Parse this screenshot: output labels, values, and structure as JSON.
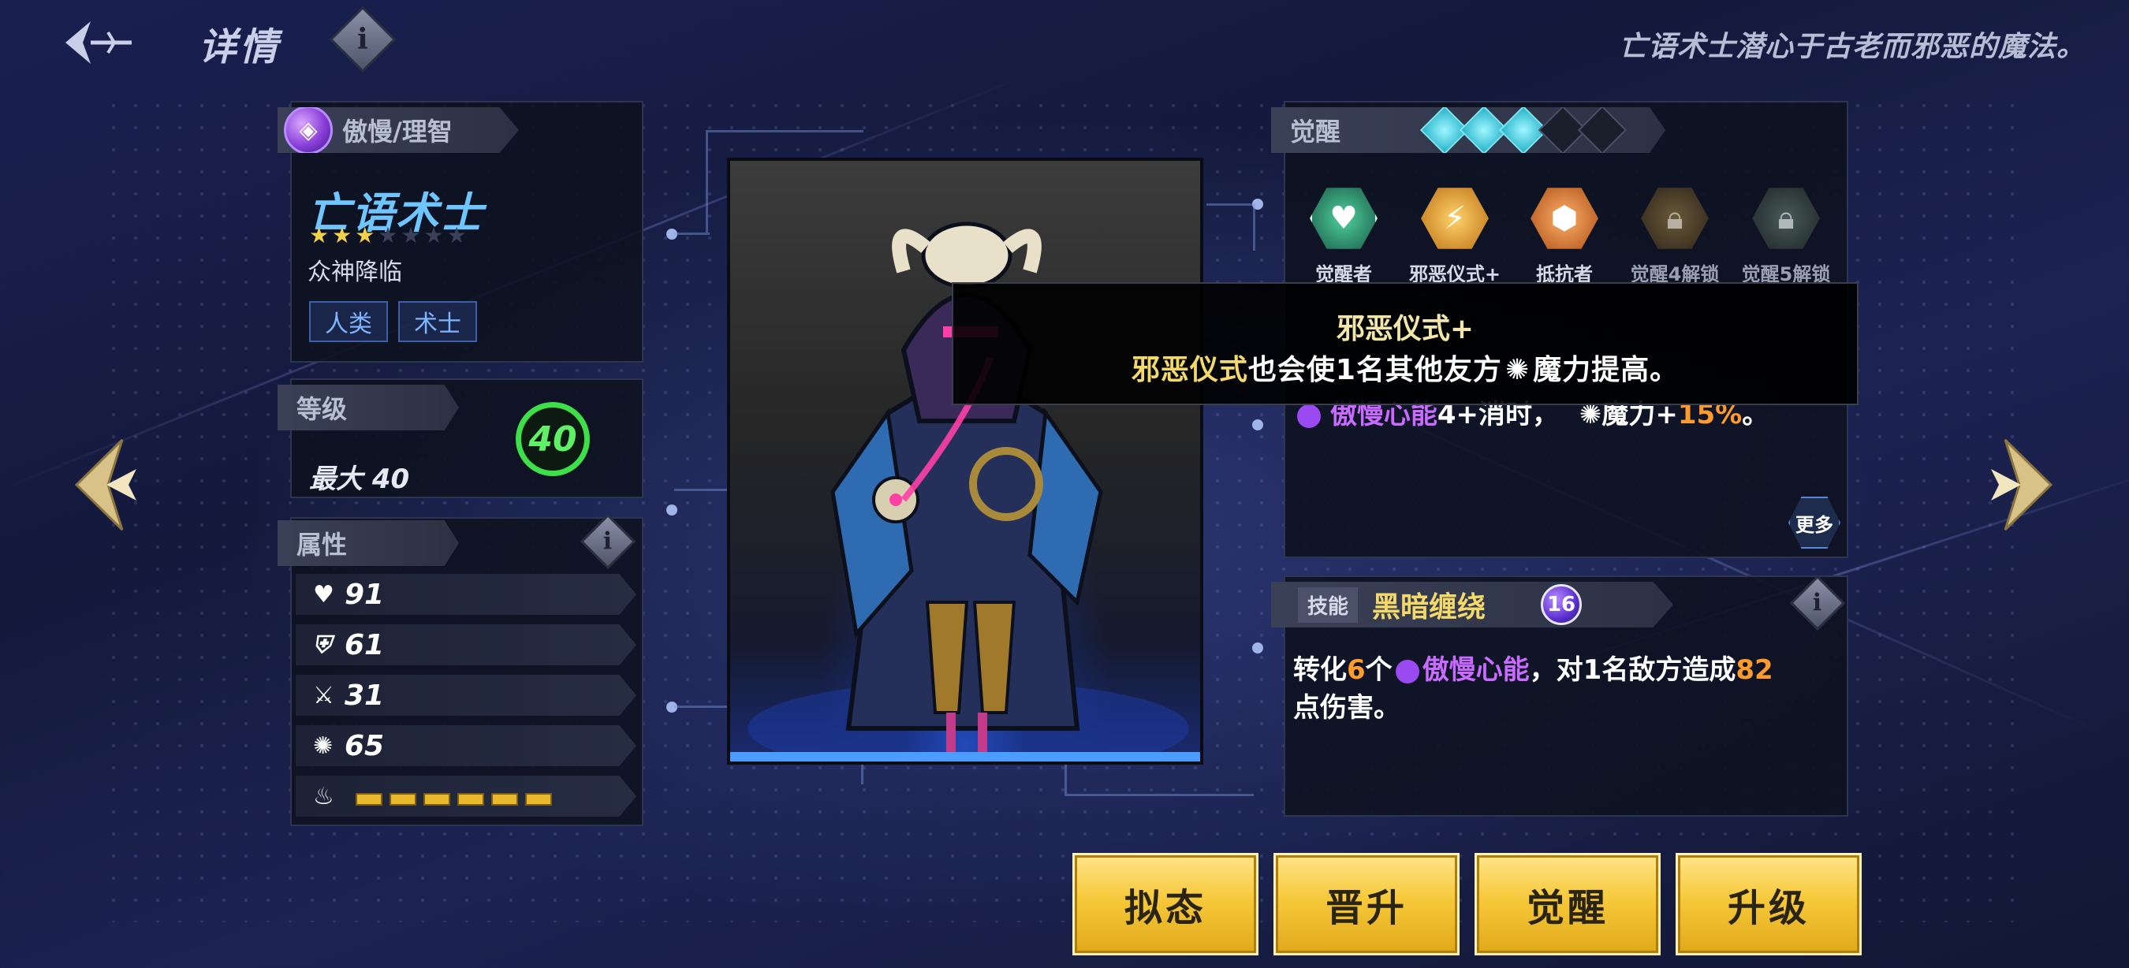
{
  "header": {
    "title": "详情",
    "flavor_text": "亡语术士潜心于古老而邪恶的魔法。"
  },
  "hero": {
    "affinity": "傲慢/理智",
    "name": "亡语术士",
    "stars_filled": 3,
    "stars_total": 7,
    "origin": "众神降临",
    "tags": [
      "人类",
      "术士"
    ]
  },
  "level": {
    "label": "等级",
    "max_text": "最大 40",
    "current": "40",
    "ring_color": "#3ee04a"
  },
  "attributes": {
    "label": "属性",
    "health": "91",
    "defense": "61",
    "attack": "31",
    "magic": "65",
    "energy_segments": 6
  },
  "awaken": {
    "label": "觉醒",
    "stars_filled": 3,
    "stars_total": 5,
    "skills": [
      {
        "label": "觉醒者",
        "icon": "awakener-icon",
        "color": "#2f8f6a"
      },
      {
        "label": "邪恶仪式+",
        "icon": "evil-ritual-icon",
        "color": "#d99a2a"
      },
      {
        "label": "抵抗者",
        "icon": "resister-icon",
        "color": "#d9782a"
      },
      {
        "label": "觉醒4解锁",
        "icon": "lock-icon",
        "color": "#5a4a3a"
      },
      {
        "label": "觉醒5解锁",
        "icon": "lock-icon",
        "color": "#3a4a4a"
      }
    ],
    "partial_text_a": "傲慢心能",
    "partial_text_b": "4+消时，",
    "partial_text_c": "魔力+",
    "partial_text_d": "15%",
    "partial_text_e": "。",
    "more_label": "更多"
  },
  "tooltip": {
    "title": "邪恶仪式+",
    "body_a": "邪恶仪式",
    "body_b": "也会使1名其他友方",
    "body_c": "魔力提高。"
  },
  "skill": {
    "tab_label": "技能",
    "name": "黑暗缠绕",
    "cost": "16",
    "desc_a": "转化",
    "desc_b": "6",
    "desc_c": "个",
    "desc_d": "傲慢心能",
    "desc_e": "，对1名敌方造成",
    "desc_f": "82",
    "desc_g": "点伤害。"
  },
  "buttons": {
    "simulate": "拟态",
    "promote": "晋升",
    "awaken": "觉醒",
    "upgrade": "升级"
  },
  "colors": {
    "accent_gold": "#f6c93a",
    "accent_cyan": "#6fc6ff",
    "purple": "#c96bff",
    "orange": "#ff9b2b"
  }
}
